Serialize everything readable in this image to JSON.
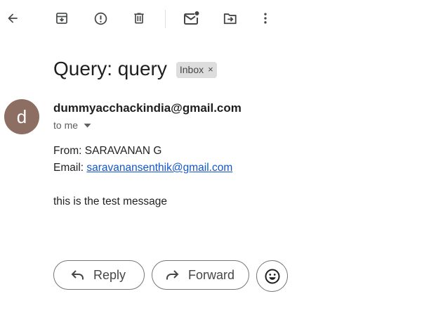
{
  "toolbar": {
    "back": "arrow-left-icon",
    "archive": "archive-icon",
    "report_spam": "report-spam-icon",
    "delete": "delete-icon",
    "mark_unread": "mark-unread-icon",
    "move_to": "move-to-icon",
    "more": "more-vert-icon"
  },
  "message": {
    "subject": "Query: query",
    "label": "Inbox",
    "label_remove": "×",
    "avatar_letter": "d",
    "sender": "dummyacchackindia@gmail.com",
    "recipients": "to me",
    "body": {
      "from_line": "From: SARAVANAN G",
      "email_prefix": "Email: ",
      "email_link": "saravanansenthik@gmail.com",
      "text": "this is the test message"
    }
  },
  "actions": {
    "reply_label": "Reply",
    "forward_label": "Forward",
    "emoji": "emoji-reaction-icon"
  },
  "colors": {
    "avatar": "#8d6e63",
    "link": "#1155cc",
    "chip": "#dddddd"
  }
}
